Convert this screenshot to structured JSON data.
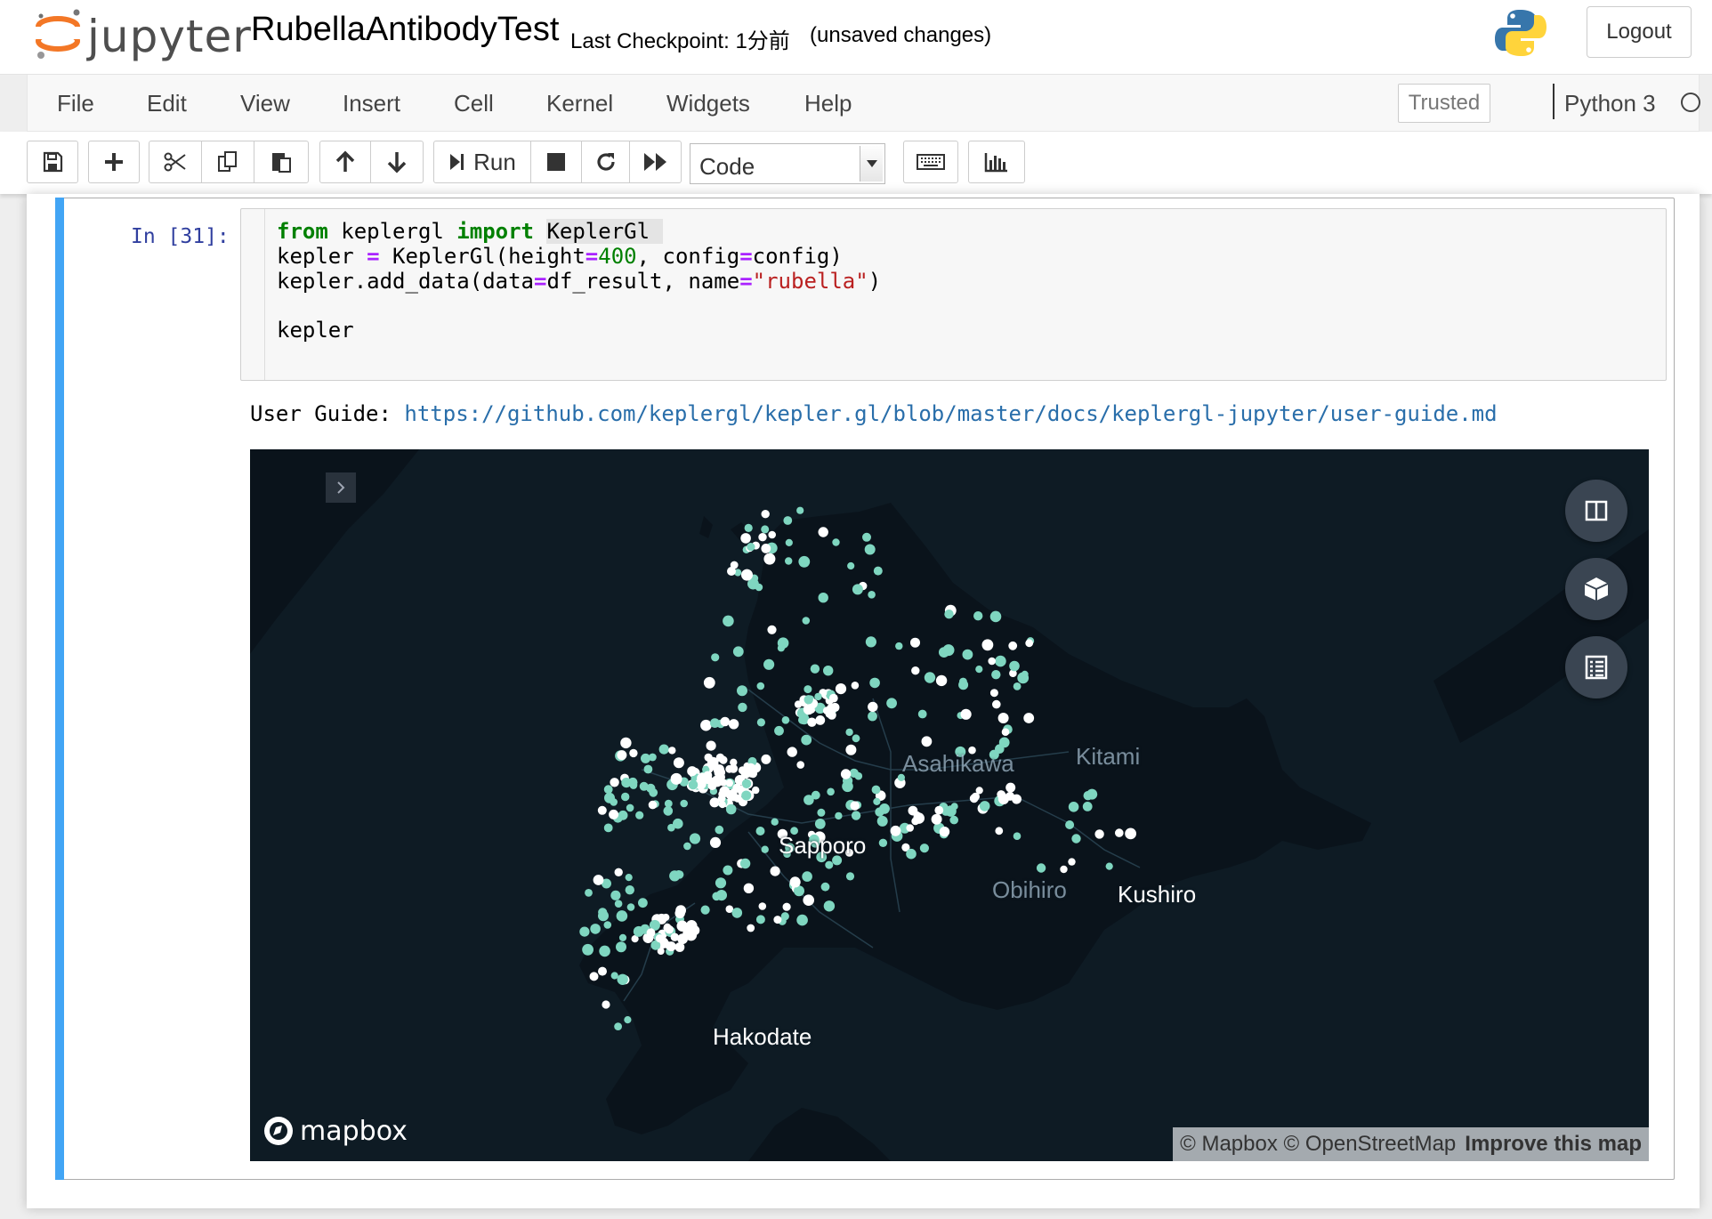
{
  "header": {
    "logo_text": "jupyter",
    "notebook_title": "RubellaAntibodyTest",
    "checkpoint": "Last Checkpoint: 1分前",
    "unsaved": "(unsaved changes)",
    "logout_label": "Logout"
  },
  "menubar": {
    "items": [
      "File",
      "Edit",
      "View",
      "Insert",
      "Cell",
      "Kernel",
      "Widgets",
      "Help"
    ],
    "trusted_label": "Trusted",
    "kernel_name": "Python 3"
  },
  "toolbar": {
    "run_label": "Run",
    "cell_type": "Code"
  },
  "cell": {
    "prompt": "In [31]:",
    "code": {
      "line1_kw1": "from",
      "line1_mod": " keplergl ",
      "line1_kw2": "import",
      "line1_name": "KeplerGl",
      "line2": "kepler = KeplerGl(height=400, config=config)",
      "line3": "kepler.add_data(data=df_result, name=\"rubella\")",
      "line5": "kepler"
    },
    "output": {
      "user_guide_label": "User Guide: ",
      "user_guide_url": "https://github.com/keplergl/kepler.gl/blob/master/docs/keplergl-jupyter/user-guide.md"
    }
  },
  "map": {
    "city_labels": [
      "Asahikawa",
      "Kitami",
      "Sapporo",
      "Obihiro",
      "Kushiro",
      "Hakodate"
    ],
    "logo_text": "mapbox",
    "attribution": "© Mapbox © OpenStreetMap",
    "improve_label": "Improve this map",
    "point_colors": {
      "teal": "#7fd6c0",
      "white": "#ffffff"
    },
    "land_color": "#0a131b",
    "water_color": "#0e1b24"
  }
}
